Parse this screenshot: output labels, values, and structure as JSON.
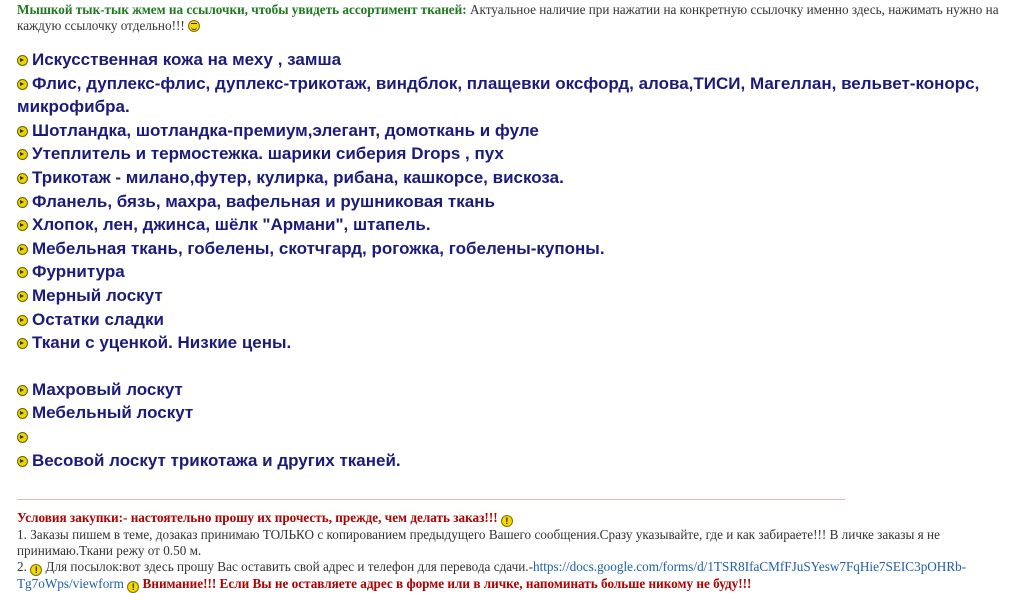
{
  "intro": {
    "lead": "Мышкой тык-тык жмем на ссылочки, чтобы увидеть ассортимент тканей:",
    "text": " Актуальное наличие при нажатии на конкретную ссылочку именно здесь, нажимать нужно на каждую ссылочку отдельно!!! ",
    "smile_icon": "smile-icon"
  },
  "links": [
    "Искусственная кожа на меху , замша",
    "Флис, дуплекс-флис, дуплекс-трикотаж, виндблок, плащевки оксфорд, алова,ТИСИ, Магеллан, вельвет-конорс, микрофибра.",
    "Шотландка, шотландка-премиум,элегант, домоткань и фуле",
    "Утеплитель и термостежка. шарики сиберия Drops , пух",
    "Трикотаж - милано,футер, кулирка, рибана, кашкорсе, вискоза.",
    "Фланель, бязь, махра, вафельная и рушниковая ткань",
    "Хлопок, лен, джинса, шёлк \"Армани\", штапель.",
    "Мебельная ткань, гобелены, скотчгард, рогожка, гобелены-купоны.",
    "Фурнитура",
    "Мерный лоскут",
    "Остатки сладки",
    "Ткани с уценкой. Низкие цены."
  ],
  "links_lower": [
    "Махровый лоскут",
    "Мебельный лоскут",
    "",
    "Весовой лоскут трикотажа и других тканей."
  ],
  "conditions": {
    "title": "Условия закупки:- настоятельно прошу их прочесть, прежде, чем делать заказ!!!",
    "item1": "1. Заказы пишем в теме, дозаказ принимаю ТОЛЬКО с копированием предыдущего Вашего сообщения.Сразу указывайте, где и как забираете!!! В личке заказы я не принимаю.Ткани режу от 0.50 м.",
    "item2_prefix": "2. ",
    "item2_text": "Для посылок:вот здесь прошу Вас оставить свой адрес и телефон для перевода сдачи.-",
    "item2_url": "https://docs.google.com/forms/d/1TSR8IfaCMfFJuSYesw7FqHie7SEIC3pOHRb-Tg7oWps/viewform",
    "item2_alert": " Внимание!!! Если Вы не оставляете адрес в форме или в личке, напоминать больше никому не буду!!!"
  },
  "colors": {
    "link": "#1b1b7a",
    "lead_green": "#1f7a1f",
    "alert_red": "#b00000",
    "url_blue": "#1f5fa8"
  }
}
